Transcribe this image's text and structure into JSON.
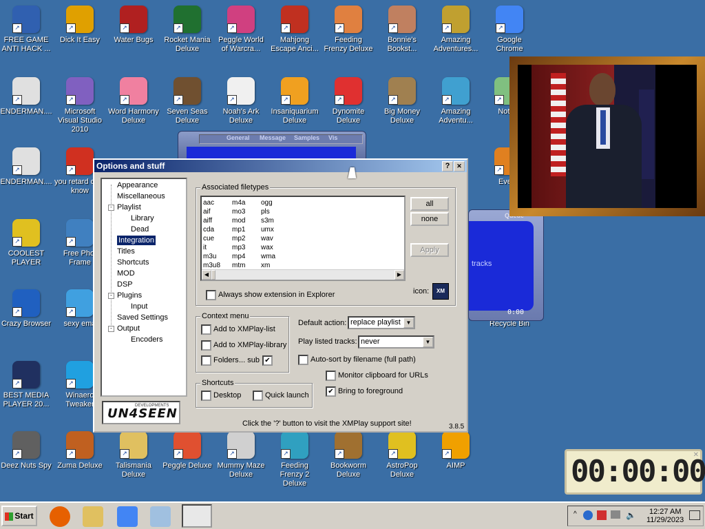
{
  "desktop_icons": [
    {
      "label": "FREE GAME ANTI HACK ...",
      "icon": "shield-icon",
      "color": "#3060b0"
    },
    {
      "label": "Dick It Easy",
      "icon": "app-icon",
      "color": "#e0a000"
    },
    {
      "label": "Water Bugs",
      "icon": "bug-icon",
      "color": "#b02020"
    },
    {
      "label": "Rocket Mania Deluxe",
      "icon": "rocket-icon",
      "color": "#207030"
    },
    {
      "label": "Peggle World of Warcra...",
      "icon": "peggle-icon",
      "color": "#d04080"
    },
    {
      "label": "Mahjong Escape Anci...",
      "icon": "gate-icon",
      "color": "#c03020"
    },
    {
      "label": "Feeding Frenzy Deluxe",
      "icon": "fish-icon",
      "color": "#e08040"
    },
    {
      "label": "Bonnie's Bookst...",
      "icon": "character-icon",
      "color": "#c08060"
    },
    {
      "label": "Amazing Adventures...",
      "icon": "compass-icon",
      "color": "#c0a030"
    },
    {
      "label": "Google Chrome",
      "icon": "chrome-icon",
      "color": "#4285f4"
    },
    {
      "label": "ENDERMAN....",
      "icon": "document-icon",
      "color": "#e0e0e0"
    },
    {
      "label": "Microsoft Visual Studio 2010",
      "icon": "infinity-icon",
      "color": "#8060c0"
    },
    {
      "label": "Word Harmony Deluxe",
      "icon": "flower-icon",
      "color": "#f080a0"
    },
    {
      "label": "Seven Seas Deluxe",
      "icon": "pirate-icon",
      "color": "#705030"
    },
    {
      "label": "Noah's Ark Deluxe",
      "icon": "dove-icon",
      "color": "#f0f0f0"
    },
    {
      "label": "Insaniquarium Deluxe",
      "icon": "fish-icon",
      "color": "#f0a020"
    },
    {
      "label": "Dynomite Deluxe",
      "icon": "egg-icon",
      "color": "#e03030"
    },
    {
      "label": "Big Money Deluxe",
      "icon": "money-bag-icon",
      "color": "#a08050"
    },
    {
      "label": "Amazing Adventu...",
      "icon": "gem-icon",
      "color": "#40a0d0"
    },
    {
      "label": "Notep",
      "icon": "notepad-icon",
      "color": "#80c080"
    },
    {
      "label": "ENDERMAN....",
      "icon": "document-icon",
      "color": "#e0e0e0"
    },
    {
      "label": "you retard dont know",
      "icon": "app-icon",
      "color": "#d03020"
    },
    {
      "label": "Every",
      "icon": "app-icon",
      "color": "#e08020"
    },
    {
      "label": "COOLEST PLAYER",
      "icon": "character-icon",
      "color": "#e0c020"
    },
    {
      "label": "Free Phot Frame",
      "icon": "photo-frame-icon",
      "color": "#4080c0"
    },
    {
      "label": "Crazy Browser",
      "icon": "star-icon",
      "color": "#2060c0"
    },
    {
      "label": "sexy ema",
      "icon": "email-icon",
      "color": "#40a0e0"
    },
    {
      "label": "Recycle Bin",
      "icon": "recycle-bin-icon",
      "color": "#e0e0e0"
    },
    {
      "label": "BEST MEDIA PLAYER 20...",
      "icon": "xmplay-icon",
      "color": "#203060"
    },
    {
      "label": "Winaero Tweaker",
      "icon": "tweaker-icon",
      "color": "#20a0e0"
    },
    {
      "label": "Deez Nuts Spy",
      "icon": "window-stack-icon",
      "color": "#606060"
    },
    {
      "label": "Zuma Deluxe",
      "icon": "zuma-icon",
      "color": "#c06020"
    },
    {
      "label": "Talismania Deluxe",
      "icon": "character-icon",
      "color": "#e0c060"
    },
    {
      "label": "Peggle Deluxe",
      "icon": "peggle-icon",
      "color": "#e05030"
    },
    {
      "label": "Mummy Maze Deluxe",
      "icon": "mummy-icon",
      "color": "#d0d0d0"
    },
    {
      "label": "Feeding Frenzy 2 Deluxe",
      "icon": "fish-icon",
      "color": "#30a0c0"
    },
    {
      "label": "Bookworm Deluxe",
      "icon": "book-icon",
      "color": "#a07030"
    },
    {
      "label": "AstroPop Deluxe",
      "icon": "astropop-icon",
      "color": "#e0c020"
    },
    {
      "label": "AIMP",
      "icon": "aimp-icon",
      "color": "#f0a000"
    }
  ],
  "dialog": {
    "title": "Options and stuff",
    "help_label": "?",
    "close_label": "✕",
    "tree": [
      {
        "label": "Appearance",
        "level": 0,
        "expander": ""
      },
      {
        "label": "Miscellaneous",
        "level": 0,
        "expander": ""
      },
      {
        "label": "Playlist",
        "level": 0,
        "expander": "-"
      },
      {
        "label": "Library",
        "level": 1,
        "expander": ""
      },
      {
        "label": "Dead",
        "level": 1,
        "expander": ""
      },
      {
        "label": "Integration",
        "level": 0,
        "expander": "",
        "selected": true
      },
      {
        "label": "Titles",
        "level": 0,
        "expander": ""
      },
      {
        "label": "Shortcuts",
        "level": 0,
        "expander": ""
      },
      {
        "label": "MOD",
        "level": 0,
        "expander": ""
      },
      {
        "label": "DSP",
        "level": 0,
        "expander": ""
      },
      {
        "label": "Plugins",
        "level": 0,
        "expander": "-"
      },
      {
        "label": "Input",
        "level": 1,
        "expander": ""
      },
      {
        "label": "Saved Settings",
        "level": 0,
        "expander": ""
      },
      {
        "label": "Output",
        "level": 0,
        "expander": "-"
      },
      {
        "label": "Encoders",
        "level": 1,
        "expander": ""
      }
    ],
    "logo_text": "UN4SEEN",
    "logo_sub": "DEVELOPMENTS",
    "assoc_label": "Associated filetypes",
    "filetypes": [
      [
        "aac",
        "aif",
        "aiff",
        "cda",
        "cue",
        "it",
        "m3u",
        "m3u8"
      ],
      [
        "m4a",
        "mo3",
        "mod",
        "mp1",
        "mp2",
        "mp3",
        "mp4",
        "mtm"
      ],
      [
        "ogg",
        "pls",
        "s3m",
        "umx",
        "wav",
        "wax",
        "wma",
        "xm"
      ]
    ],
    "btn_all": "all",
    "btn_none": "none",
    "btn_apply": "Apply",
    "always_ext_label": "Always show extension in Explorer",
    "always_ext_checked": false,
    "icon_label": "icon:",
    "context_label": "Context menu",
    "ctx_add_list": "Add to XMPlay-list",
    "ctx_add_list_checked": false,
    "ctx_add_library": "Add to XMPlay-library",
    "ctx_add_library_checked": false,
    "ctx_folders": "Folders",
    "ctx_folders_checked": false,
    "ctx_sub": "... sub",
    "ctx_sub_checked": true,
    "default_action_label": "Default action:",
    "default_action_value": "replace playlist",
    "play_listed_label": "Play listed tracks:",
    "play_listed_value": "never",
    "autosort_label": "Auto-sort by filename (full path)",
    "autosort_checked": false,
    "monitor_label": "Monitor clipboard for URLs",
    "monitor_checked": false,
    "bring_label": "Bring to foreground",
    "bring_checked": true,
    "shortcuts_label": "Shortcuts",
    "desktop_label": "Desktop",
    "desktop_checked": false,
    "quick_label": "Quick launch",
    "quick_checked": false,
    "footer_text": "Click the '?' button to visit the XMPlay support site!",
    "version": "3.8.5"
  },
  "xmplay_bg": {
    "tabs": [
      "General",
      "Message",
      "Samples",
      "Vis"
    ],
    "queue_label": "Queue",
    "tracks_label": "tracks",
    "time": "0:00"
  },
  "clock_widget": {
    "display": "00:00:00"
  },
  "taskbar": {
    "start_label": "Start",
    "quick": [
      {
        "name": "firefox-icon",
        "color": "#e66000"
      },
      {
        "name": "explorer-icon",
        "color": "#e0c060"
      },
      {
        "name": "chrome-icon",
        "color": "#4285f4"
      },
      {
        "name": "notepad-icon",
        "color": "#a0c0e0"
      },
      {
        "name": "xmplay-icon",
        "color": "#203060"
      }
    ],
    "time": "12:27 AM",
    "date": "11/29/2023"
  }
}
